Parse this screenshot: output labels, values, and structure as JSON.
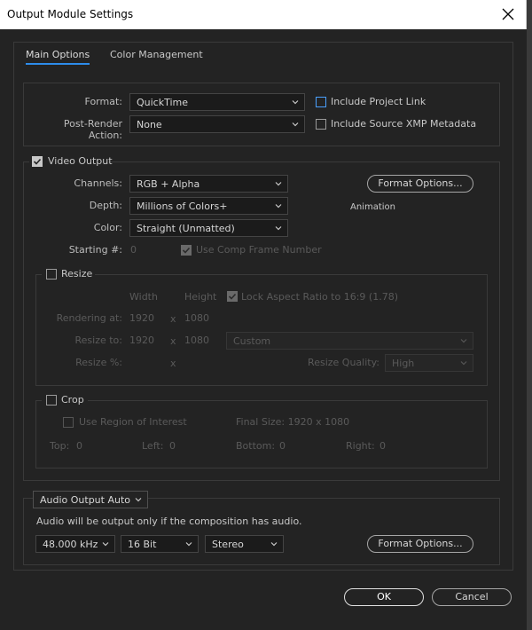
{
  "window": {
    "title": "Output Module Settings"
  },
  "tabs": [
    {
      "label": "Main Options",
      "active": true
    },
    {
      "label": "Color Management",
      "active": false
    }
  ],
  "format": {
    "format_label": "Format:",
    "format_value": "QuickTime",
    "post_render_label": "Post-Render Action:",
    "post_render_value": "None",
    "include_project_link": "Include Project Link",
    "include_xmp": "Include Source XMP Metadata"
  },
  "video": {
    "section_label": "Video Output",
    "channels_label": "Channels:",
    "channels_value": "RGB + Alpha",
    "depth_label": "Depth:",
    "depth_value": "Millions of Colors+",
    "color_label": "Color:",
    "color_value": "Straight (Unmatted)",
    "starting_label": "Starting #:",
    "starting_value": "0",
    "use_comp_frame": "Use Comp Frame Number",
    "format_options": "Format Options...",
    "codec": "Animation"
  },
  "resize": {
    "label": "Resize",
    "width_header": "Width",
    "height_header": "Height",
    "lock_aspect": "Lock Aspect Ratio to 16:9 (1.78)",
    "rendering_at_label": "Rendering at:",
    "rendering_w": "1920",
    "rendering_h": "1080",
    "resize_to_label": "Resize to:",
    "resize_to_w": "1920",
    "resize_to_h": "1080",
    "preset": "Custom",
    "resize_pct_label": "Resize %:",
    "x": "x",
    "quality_label": "Resize Quality:",
    "quality_value": "High"
  },
  "crop": {
    "label": "Crop",
    "use_roi": "Use Region of Interest",
    "final_size": "Final Size: 1920 x 1080",
    "top_label": "Top:",
    "top_value": "0",
    "left_label": "Left:",
    "left_value": "0",
    "bottom_label": "Bottom:",
    "bottom_value": "0",
    "right_label": "Right:",
    "right_value": "0"
  },
  "audio": {
    "output_mode": "Audio Output Auto",
    "note": "Audio will be output only if the composition has audio.",
    "sample_rate": "48.000 kHz",
    "bit_depth": "16 Bit",
    "channels": "Stereo",
    "format_options": "Format Options..."
  },
  "buttons": {
    "ok": "OK",
    "cancel": "Cancel"
  },
  "colors": {
    "accent": "#2d8ceb",
    "background": "#232323"
  }
}
